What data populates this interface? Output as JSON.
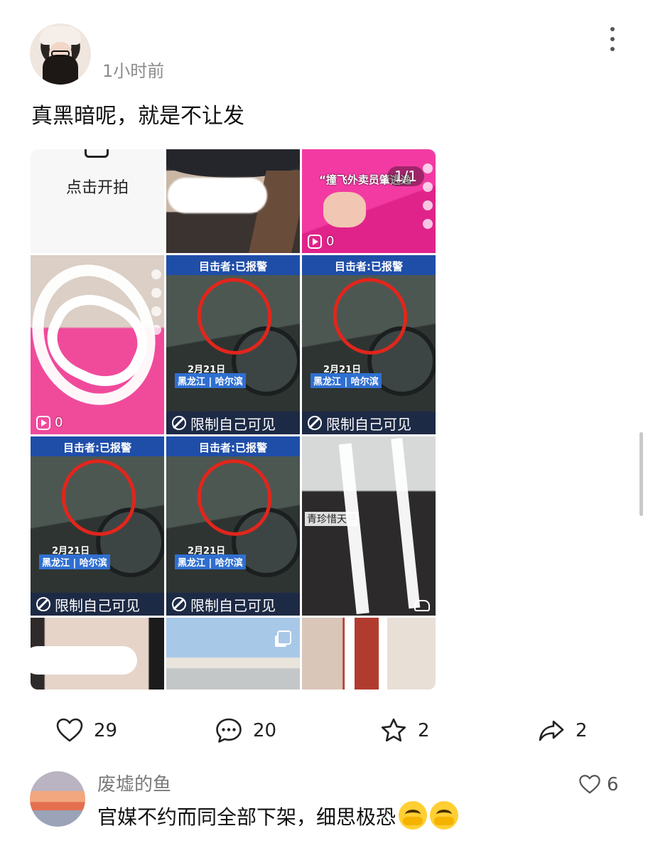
{
  "post": {
    "time": "1小时前",
    "text": "真黑暗呢，就是不让发"
  },
  "grid": {
    "shoot_label": "点击开拍",
    "pink_caption": "“撞飞外卖员肇逃逸",
    "pink_page": "1/1",
    "pink_plays": "0",
    "girl_plays": "0",
    "news_witness": "目击者:已报警",
    "news_date": "2月21日",
    "news_place": "黑龙江 | 哈尔滨",
    "restricted_label": "限制自己可见",
    "street_title": "青珍惜天秤"
  },
  "actions": {
    "likes": "29",
    "comments": "20",
    "favorites": "2",
    "shares": "2"
  },
  "comment": {
    "user": "废墟的鱼",
    "text": "官媒不约而同全部下架，细思极恐",
    "likes": "6"
  }
}
